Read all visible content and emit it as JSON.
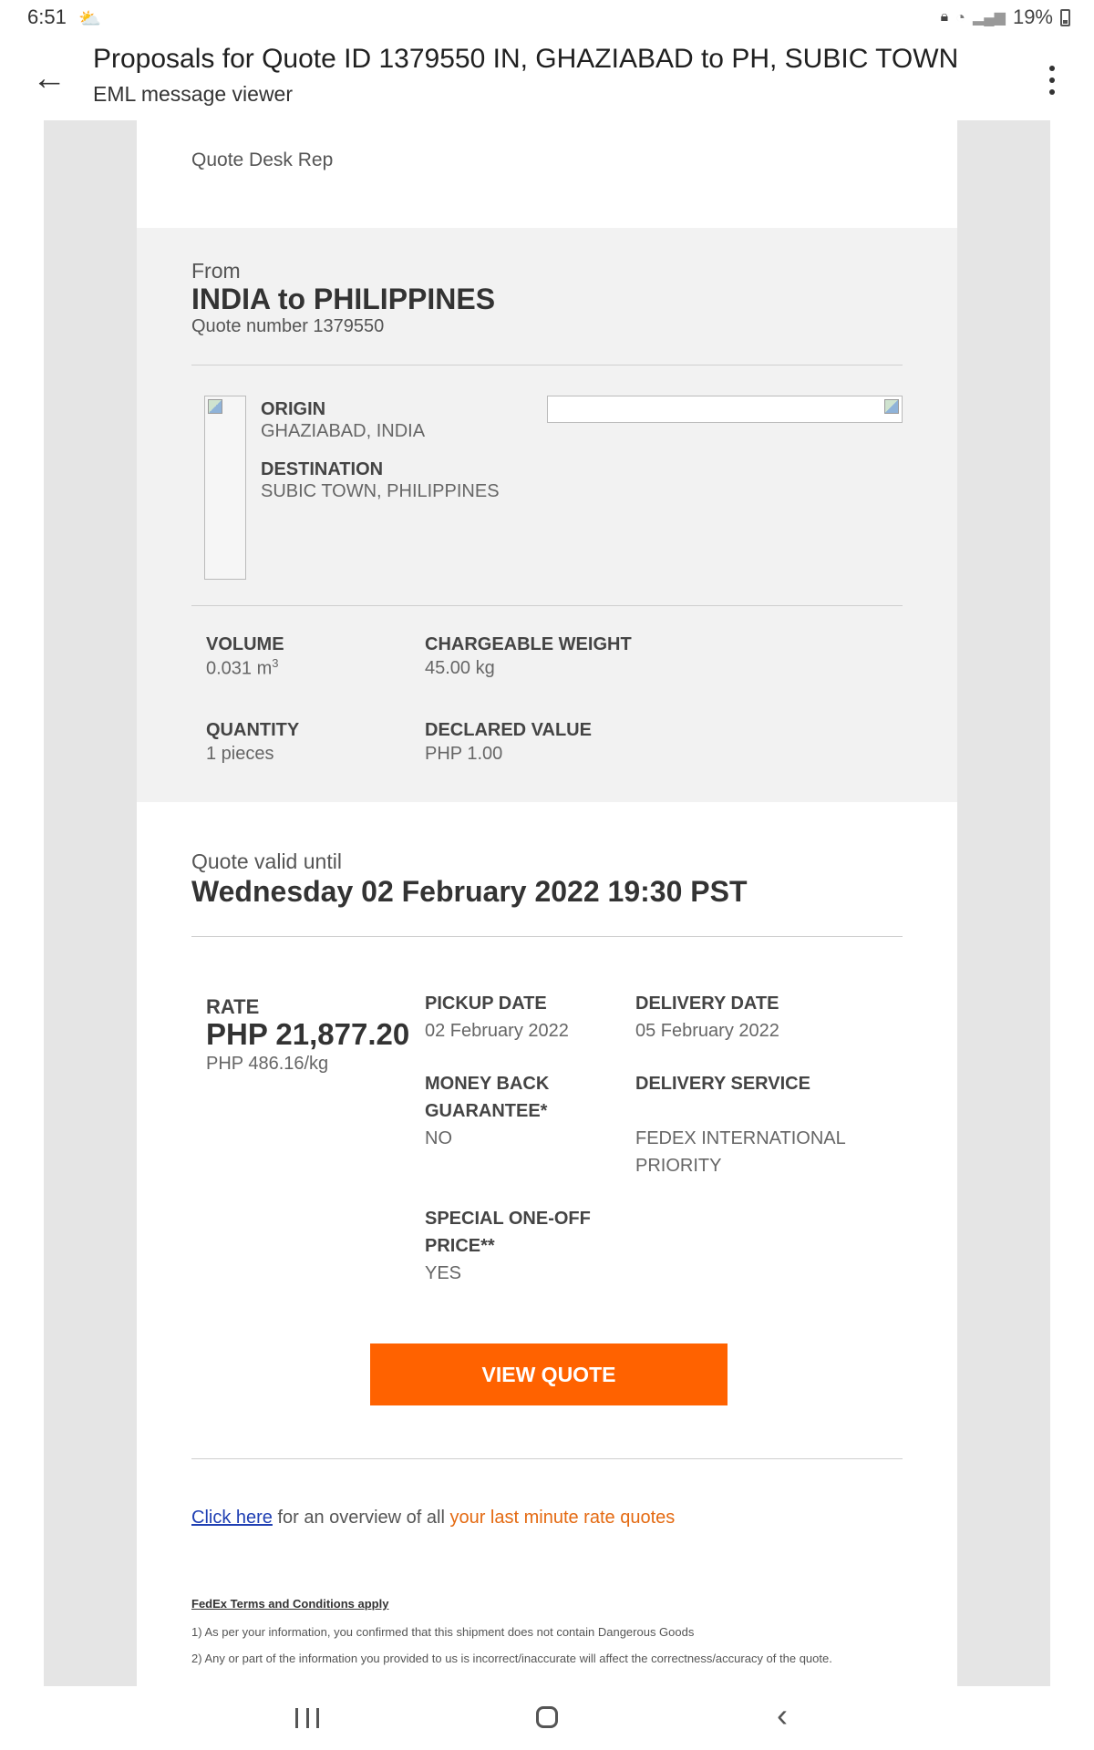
{
  "status_bar": {
    "time": "6:51",
    "battery": "19%"
  },
  "app_bar": {
    "title": "Proposals for Quote ID 1379550 IN, GHAZIABAD to PH, SUBIC TOWN",
    "subtitle": "EML message viewer"
  },
  "email": {
    "rep": "Quote Desk Rep",
    "from_label": "From",
    "route_title": "INDIA to PHILIPPINES",
    "quote_number": "Quote number 1379550",
    "origin_label": "ORIGIN",
    "origin_value": "GHAZIABAD, INDIA",
    "destination_label": "DESTINATION",
    "destination_value": "SUBIC TOWN, PHILIPPINES",
    "volume_label": "VOLUME",
    "volume_value": "0.031 m",
    "volume_sup": "3",
    "chargeable_weight_label": "CHARGEABLE WEIGHT",
    "chargeable_weight_value": "45.00 kg",
    "quantity_label": "QUANTITY",
    "quantity_value": "1 pieces",
    "declared_value_label": "DECLARED VALUE",
    "declared_value_value": "PHP 1.00",
    "valid_label": "Quote valid until",
    "valid_date": "Wednesday 02 February 2022 19:30 PST",
    "rate_label": "RATE",
    "rate_value": "PHP 21,877.20",
    "rate_per_kg": "PHP 486.16/kg",
    "pickup_label": "PICKUP DATE",
    "pickup_value": "02 February 2022",
    "delivery_date_label": "DELIVERY DATE",
    "delivery_date_value": "05 February 2022",
    "money_back_label_1": "MONEY BACK",
    "money_back_label_2": "GUARANTEE*",
    "money_back_value": "NO",
    "delivery_service_label": "DELIVERY SERVICE",
    "delivery_service_value_1": "FEDEX INTERNATIONAL",
    "delivery_service_value_2": "PRIORITY",
    "special_label_1": "SPECIAL ONE-OFF",
    "special_label_2": "PRICE**",
    "special_value": "YES",
    "view_quote_button": "VIEW QUOTE",
    "click_here_link": "Click here",
    "overview_text": " for an overview of all ",
    "last_minute_link": "your last minute rate quotes",
    "terms_title": "FedEx Terms and Conditions apply",
    "terms_1": "1) As per your information, you confirmed that this shipment does not contain Dangerous Goods",
    "terms_2": "2) Any or part of the information you provided to us is incorrect/inaccurate will affect the correctness/accuracy of the quote."
  },
  "icons": {
    "weather": "weather-icon",
    "lock": "lock-icon",
    "wifi": "wifi-icon",
    "signal": "signal-icon",
    "battery": "battery-icon",
    "back": "back-arrow-icon",
    "more": "more-vert-icon"
  },
  "colors": {
    "accent_orange": "#ff6200",
    "link_blue": "#1f3fb3",
    "link_orange": "#e46a12",
    "panel_grey": "#f2f2f2"
  }
}
